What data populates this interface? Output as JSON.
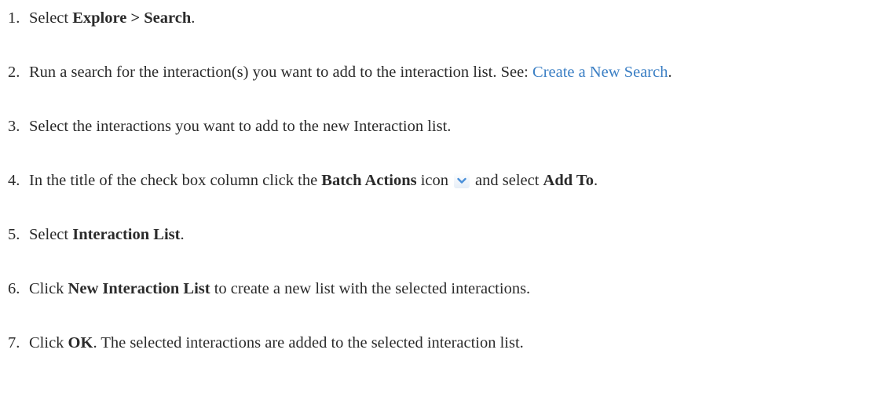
{
  "steps": [
    {
      "number": "1.",
      "text_before": "Select ",
      "bold": "Explore > Search",
      "text_after": "."
    },
    {
      "number": "2.",
      "text_before": "Run a search for the interaction(s) you want to add to the interaction list. See: ",
      "link": "Create a New Search",
      "text_after": "."
    },
    {
      "number": "3.",
      "text": "Select the interactions you want to add to the new Interaction list."
    },
    {
      "number": "4.",
      "text_before": "In the title of the check box column click the ",
      "bold": "Batch Actions",
      "text_middle": " icon",
      "icon": "chevron-down-icon",
      "text_middle2": "and select ",
      "bold2": "Add To",
      "text_after": "."
    },
    {
      "number": "5.",
      "text_before": "Select ",
      "bold": "Interaction List",
      "text_after": "."
    },
    {
      "number": "6.",
      "text_before": "Click ",
      "bold": "New Interaction List",
      "text_after": " to create a new list with the selected interactions."
    },
    {
      "number": "7.",
      "text_before": "Click ",
      "bold": "OK",
      "text_after": ". The selected interactions are added to the selected interaction list."
    }
  ],
  "colors": {
    "text": "#2b2b2b",
    "link": "#3b7fc4",
    "icon": "#4a90d9"
  }
}
